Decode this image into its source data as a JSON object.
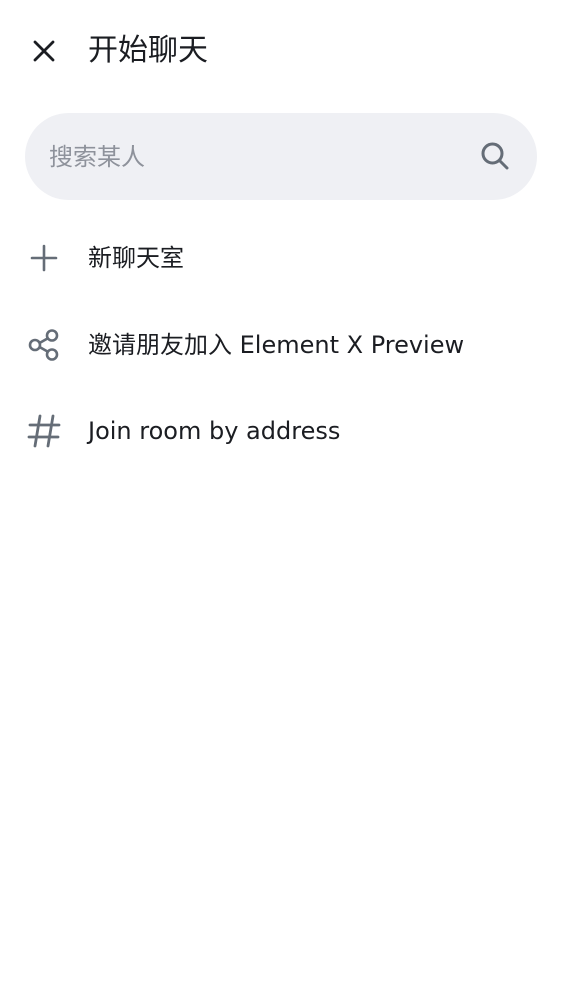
{
  "header": {
    "title": "开始聊天",
    "close_icon": "close-icon"
  },
  "search": {
    "placeholder": "搜索某人",
    "value": "",
    "icon": "search-icon"
  },
  "menu": {
    "items": [
      {
        "label": "新聊天室",
        "icon": "plus-icon"
      },
      {
        "label": "邀请朋友加入 Element X Preview",
        "icon": "share-icon"
      },
      {
        "label": "Join room by address",
        "icon": "hash-icon"
      }
    ]
  },
  "colors": {
    "background": "#ffffff",
    "text": "#1b1d22",
    "icon": "#656d77",
    "search_bg": "#eff0f4",
    "placeholder": "#8e929b"
  }
}
